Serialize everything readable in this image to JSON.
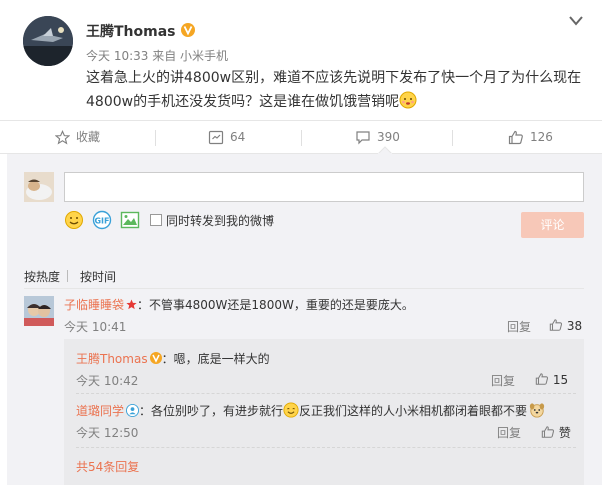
{
  "post": {
    "author": "王腾Thomas",
    "time": "今天 10:33 来自 小米手机",
    "content": "这着急上火的讲4800w区别，难道不应该先说明下发布了快一个月了为什么现在4800w的手机还没发货吗？这是谁在做饥饿营销呢"
  },
  "actions": {
    "favorite": "收藏",
    "repost": "64",
    "comment": "390",
    "like": "126"
  },
  "composer": {
    "repost_label": "同时转发到我的微博",
    "submit": "评论"
  },
  "sort": {
    "hot": "按热度",
    "time": "按时间"
  },
  "comment": {
    "user": "子临睡睡袋",
    "text": "：不管事4800W还是1800W，重要的还是要庞大。",
    "time": "今天 10:41",
    "reply": "回复",
    "likes": "38"
  },
  "replies": [
    {
      "user": "王腾Thomas",
      "text": "：嗯，底是一样大的",
      "time": "今天 10:42",
      "reply": "回复",
      "likes": "15"
    },
    {
      "user": "道璐同学",
      "text1": "：各位别吵了，有进步就行",
      "text2": "反正我们这样的人小米相机都闭着眼都不要",
      "time": "今天 12:50",
      "reply": "回复",
      "likes": "赞"
    }
  ],
  "more_replies": "共54条回复",
  "colors": {
    "link": "#eb7350",
    "gold_badge": "#f5a623",
    "button": "#f7c8b8"
  }
}
